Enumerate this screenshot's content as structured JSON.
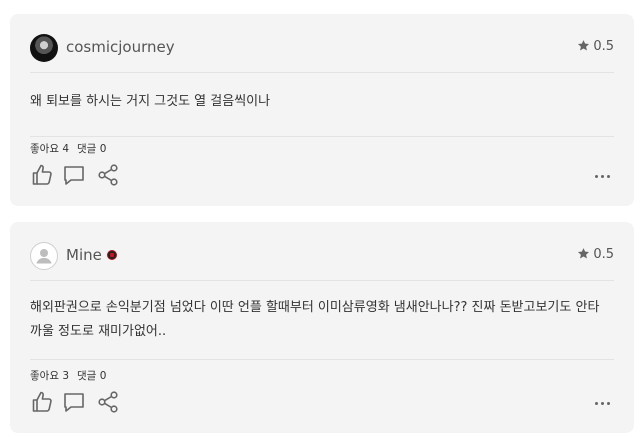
{
  "reviews": [
    {
      "username": "cosmicjourney",
      "avatar": "profile-photo",
      "has_badge": false,
      "rating": "0.5",
      "text": "왜 퇴보를 하시는 거지 그것도 열 걸음씩이나",
      "likes_label": "좋아요",
      "likes_count": "4",
      "comments_label": "댓글",
      "comments_count": "0"
    },
    {
      "username": "Mine",
      "avatar": "default-user-icon",
      "has_badge": true,
      "rating": "0.5",
      "text": "해외판권으로 손익분기점 넘었다 이딴 언플 할때부터 이미삼류영화 냄새안나나?? 진짜 돈받고보기도 안타까울 정도로 재미가없어..",
      "likes_label": "좋아요",
      "likes_count": "3",
      "comments_label": "댓글",
      "comments_count": "0"
    }
  ],
  "icons": {
    "rating": "star-icon",
    "like": "thumbs-up-icon",
    "comment": "comment-icon",
    "share": "share-icon",
    "more": "more-options-icon"
  },
  "colors": {
    "card_background": "#f4f4f5",
    "text": "#333333",
    "icon": "#666666"
  }
}
